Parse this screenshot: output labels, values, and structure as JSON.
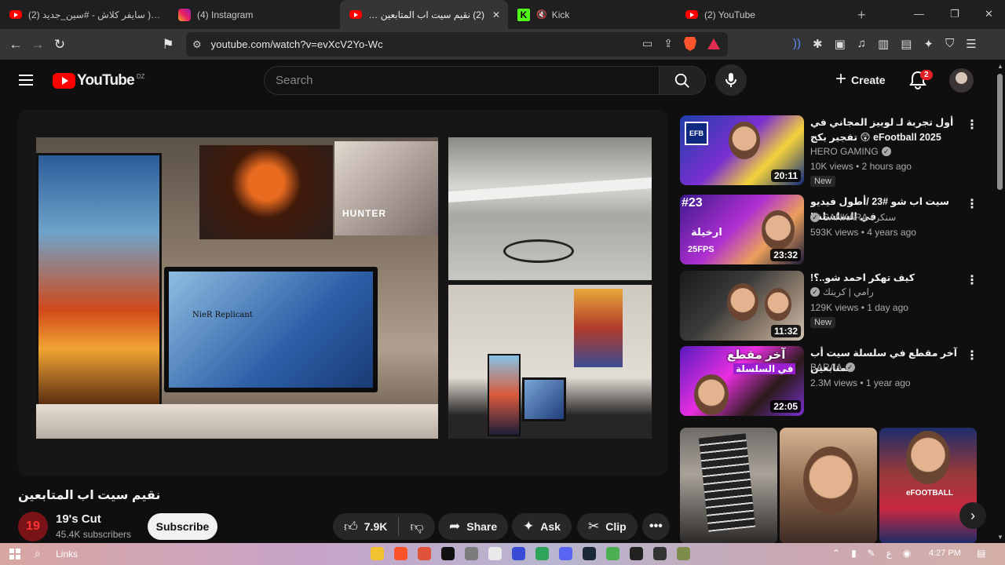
{
  "browser": {
    "tabs": [
      {
        "label": "(2) سايفر كلاش - #سين_جديد ) Video",
        "icon": "youtube-icon",
        "active": false
      },
      {
        "label": "(4) Instagram",
        "icon": "instagram-icon",
        "active": false
      },
      {
        "label": "(2) نقيم سيت اب المتابعين - YouTube",
        "icon": "youtube-icon",
        "active": true
      },
      {
        "label": "Kick",
        "icon": "kick-icon",
        "active": false
      },
      {
        "label": "(2) YouTube",
        "icon": "youtube-icon",
        "active": false
      }
    ],
    "url": "youtube.com/watch?v=evXcV2Yo-Wc"
  },
  "youtube": {
    "logo_text": "YouTube",
    "country_code": "DZ",
    "search_placeholder": "Search",
    "create_label": "Create",
    "notification_count": "2"
  },
  "video": {
    "title": "نقيم سيت اب المتابعين",
    "poster_text": "HUNTER",
    "monitor_text": "NieR Replicant",
    "channel": {
      "name": "19's Cut",
      "subscribers": "45.4K subscribers",
      "avatar_text": "19"
    },
    "subscribe_label": "Subscribe",
    "like_count": "7.9K",
    "share_label": "Share",
    "ask_label": "Ask",
    "clip_label": "Clip"
  },
  "recommendations": [
    {
      "title": "أول تجربة لـ لوبيز المجاني في eFootball 2025 😲 تفجير بكج نجوم الاسبوع وعودة",
      "channel": "HERO GAMING",
      "verified": true,
      "meta": "10K views • 2 hours ago",
      "badge": "New",
      "duration": "20:11"
    },
    {
      "title": "سيت اب شو #23 /أطول فيديو في السلسلة !",
      "channel": "SANKARA سنكرة",
      "verified": true,
      "meta": "593K views • 4 years ago",
      "badge": "",
      "duration": "23:32"
    },
    {
      "title": "كيف تهكر احمد شو..؟!",
      "channel": "رامي | كرينك",
      "verified": true,
      "meta": "129K views • 1 day ago",
      "badge": "New",
      "duration": "11:32"
    },
    {
      "title": "آخر مقطع في سلسلة سيت أب المتابعين",
      "channel": "BARAA",
      "verified": true,
      "meta": "2.3M views • 1 year ago",
      "badge": "",
      "duration": "22:05"
    }
  ],
  "thumb_text": {
    "t1": "EFB",
    "t2_hash": "#23",
    "t2_ar": "ارخيلة",
    "t2_fps": "25FPS",
    "t4_ar": "آخر مقطع",
    "t4_ar2": "في السلسلة"
  },
  "shorts_text": {
    "s3": "eFOOTBALL"
  },
  "taskbar": {
    "links_label": "Links",
    "clock": "4:27 PM"
  }
}
